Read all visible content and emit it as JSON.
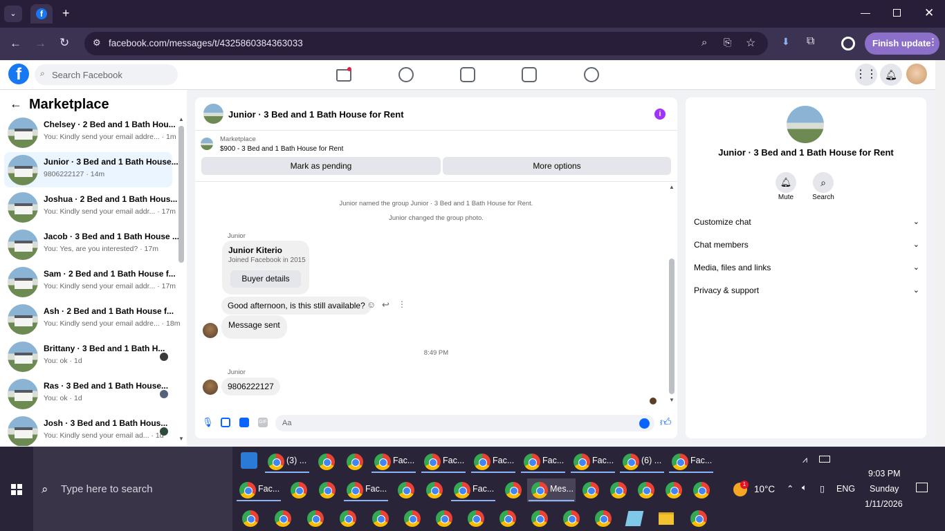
{
  "browser": {
    "url": "facebook.com/messages/t/4325860384363033",
    "finish_update": "Finish update"
  },
  "fb": {
    "search_placeholder": "Search Facebook"
  },
  "sidebar": {
    "title": "Marketplace",
    "conversations": [
      {
        "title": "Chelsey · 2 Bed and 1 Bath Hou...",
        "sub": "You: Kindly send your email addre... · 1m"
      },
      {
        "title": "Junior · 3 Bed and 1 Bath House...",
        "sub": "9806222127 · 14m"
      },
      {
        "title": "Joshua · 2 Bed and 1 Bath Hous...",
        "sub": "You: Kindly send your email addr... · 17m"
      },
      {
        "title": "Jacob · 3 Bed and 1 Bath House ...",
        "sub": "You: Yes, are you interested? · 17m"
      },
      {
        "title": "Sam · 2 Bed and 1 Bath House f...",
        "sub": "You: Kindly send your email addr... · 17m"
      },
      {
        "title": "Ash · 2 Bed and 1 Bath House f...",
        "sub": "You: Kindly send your email addre... · 18m"
      },
      {
        "title": "Brittany · 3 Bed and 1 Bath H...",
        "sub": "You: ok · 1d"
      },
      {
        "title": "Ras · 3 Bed and 1 Bath House...",
        "sub": "You: ok · 1d"
      },
      {
        "title": "Josh · 3 Bed and 1 Bath Hous...",
        "sub": "You: Kindly send your email ad... · 1d"
      }
    ]
  },
  "chat": {
    "title": "Junior · 3 Bed and 1 Bath House for Rent",
    "listing_source": "Marketplace",
    "listing": "$900 - 3 Bed and 1 Bath House for Rent",
    "mark_pending": "Mark as pending",
    "more_options": "More options",
    "sys1": "Junior named the group Junior · 3 Bed and 1 Bath House for Rent.",
    "sys2": "Junior changed the group photo.",
    "sender": "Junior",
    "card_name": "Junior Kiterio",
    "card_sub": "Joined Facebook in 2015",
    "buyer_details": "Buyer details",
    "msg_out": "Good afternoon, is this still available?",
    "msg_sent": "Message sent",
    "time": "8:49 PM",
    "sender2": "Junior",
    "msg_phone": "9806222127",
    "composer_placeholder": "Aa"
  },
  "info": {
    "title": "Junior · 3 Bed and 1 Bath House for Rent",
    "mute": "Mute",
    "search": "Search",
    "sections": [
      "Customize chat",
      "Chat members",
      "Media, files and links",
      "Privacy & support"
    ]
  },
  "taskbar": {
    "search_placeholder": "Type here to search",
    "row1": [
      "(3) ...",
      "Fac...",
      "Fac...",
      "Fac...",
      "Fac...",
      "Fac...",
      "(6) ...",
      "Fac..."
    ],
    "row2": [
      "Fac...",
      "Fac...",
      "Fac...",
      "Mes..."
    ],
    "weather": "10°C",
    "lang": "ENG",
    "time": "9:03 PM",
    "day": "Sunday",
    "date": "1/11/2026",
    "weather_badge": "1"
  }
}
